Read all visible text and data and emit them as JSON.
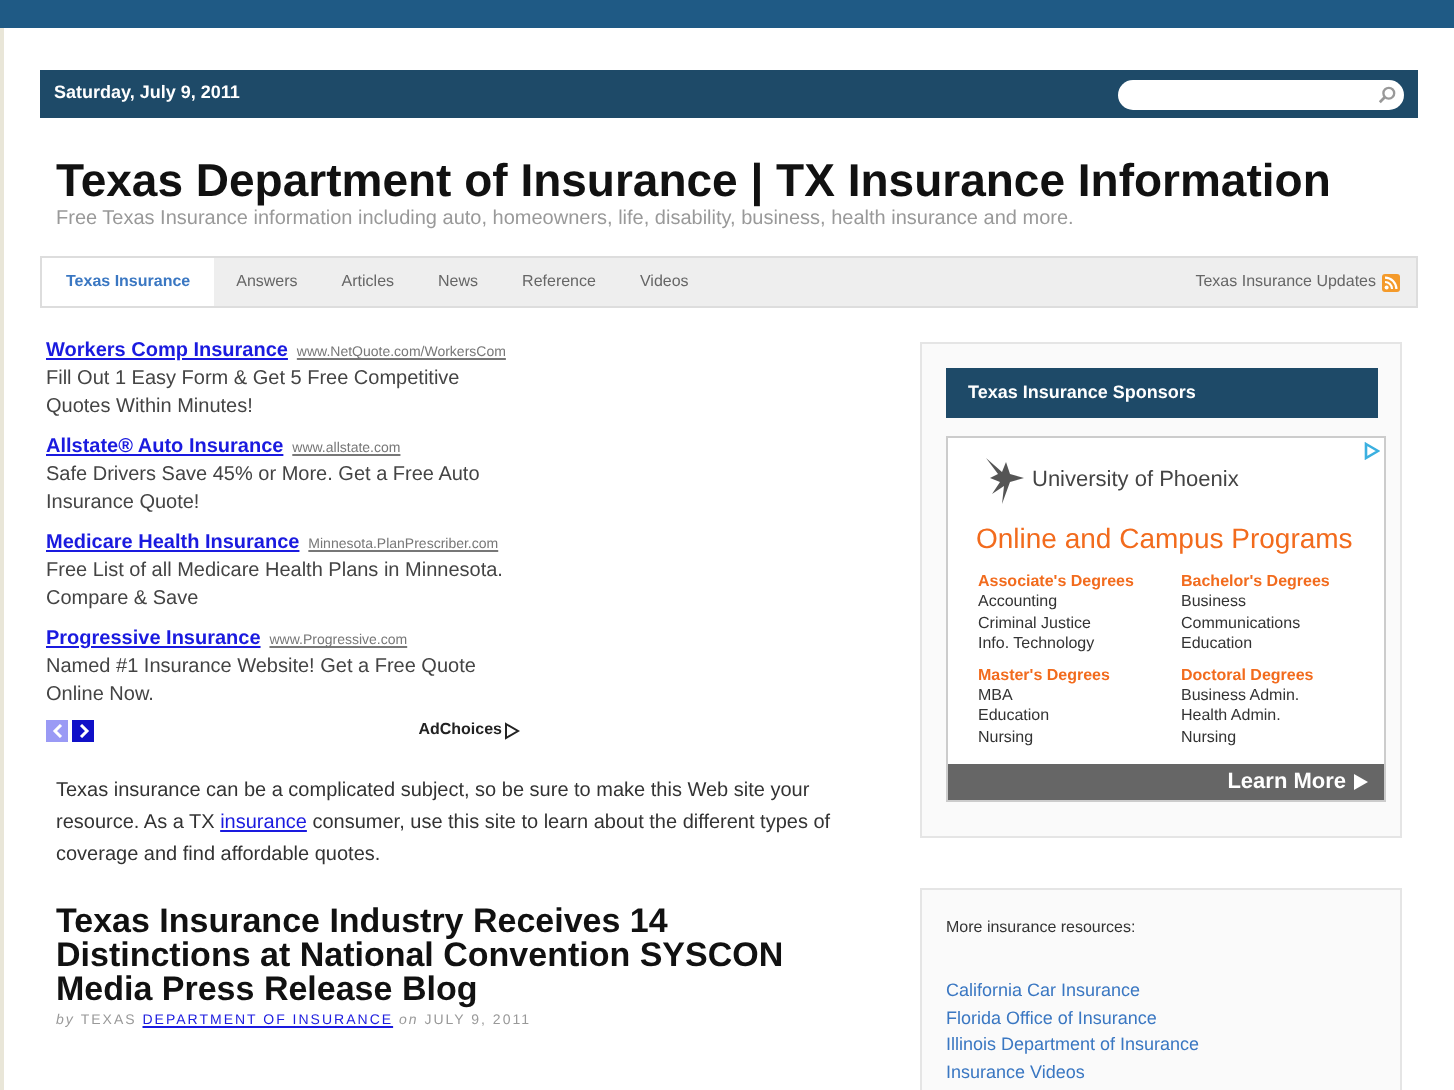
{
  "top_bar": {
    "date": "Saturday, July 9, 2011"
  },
  "header": {
    "title": "Texas Department of Insurance | TX Insurance Information",
    "tagline": "Free Texas Insurance information including auto, homeowners, life, disability, business, health insurance and more."
  },
  "nav": {
    "tabs": [
      {
        "label": "Texas Insurance",
        "selected": true
      },
      {
        "label": "Answers",
        "selected": false
      },
      {
        "label": "Articles",
        "selected": false
      },
      {
        "label": "News",
        "selected": false
      },
      {
        "label": "Reference",
        "selected": false
      },
      {
        "label": "Videos",
        "selected": false
      }
    ],
    "updates_link": "Texas Insurance Updates"
  },
  "ads": {
    "items": [
      {
        "title": "Workers Comp Insurance",
        "url": "www.NetQuote.com/WorkersCom",
        "text": "Fill Out 1 Easy Form & Get 5 Free Competitive Quotes Within Minutes!"
      },
      {
        "title": "Allstate® Auto Insurance",
        "url": "www.allstate.com",
        "text": "Safe Drivers Save 45% or More. Get a Free Auto Insurance Quote!"
      },
      {
        "title": "Medicare Health Insurance",
        "url": "Minnesota.PlanPrescriber.com",
        "text": "Free List of all Medicare Health Plans in Minnesota. Compare & Save"
      },
      {
        "title": "Progressive Insurance",
        "url": "www.Progressive.com",
        "text": "Named #1 Insurance Website! Get a Free Quote Online Now."
      }
    ],
    "prev": {
      "disabled": true
    },
    "next": {
      "disabled": false
    },
    "adchoices": "AdChoices"
  },
  "intro": {
    "before": "Texas insurance can be a complicated subject, so be sure to make this Web site your resource. As a TX",
    "link": "insurance",
    "after": "consumer, use this site to learn about the different types of coverage and find affordable quotes."
  },
  "post": {
    "title": "Texas Insurance Industry Receives 14 Distinctions at National Convention SYSCON Media Press Release Blog",
    "by": "by",
    "author_prefix": "TEXAS",
    "author_link": "DEPARTMENT OF INSURANCE",
    "on": "on",
    "date": "JULY 9, 2011"
  },
  "sponsors": {
    "heading": "Texas Insurance Sponsors",
    "ad": {
      "brand": "University of Phoenix",
      "headline": "Online and Campus Programs",
      "groups": [
        {
          "heading": "Associate's Degrees",
          "items": [
            "Accounting",
            "Criminal Justice",
            "Info. Technology"
          ]
        },
        {
          "heading": "Bachelor's Degrees",
          "items": [
            "Business",
            "Communications",
            "Education"
          ]
        },
        {
          "heading": "Master's Degrees",
          "items": [
            "MBA",
            "Education",
            "Nursing"
          ]
        },
        {
          "heading": "Doctoral Degrees",
          "items": [
            "Business Admin.",
            "Health Admin.",
            "Nursing"
          ]
        }
      ],
      "cta": "Learn More"
    }
  },
  "resources": {
    "heading": "More insurance resources:",
    "links": [
      "California Car Insurance",
      "Florida Office of Insurance",
      "Illinois Department of Insurance",
      "Insurance Videos"
    ]
  }
}
